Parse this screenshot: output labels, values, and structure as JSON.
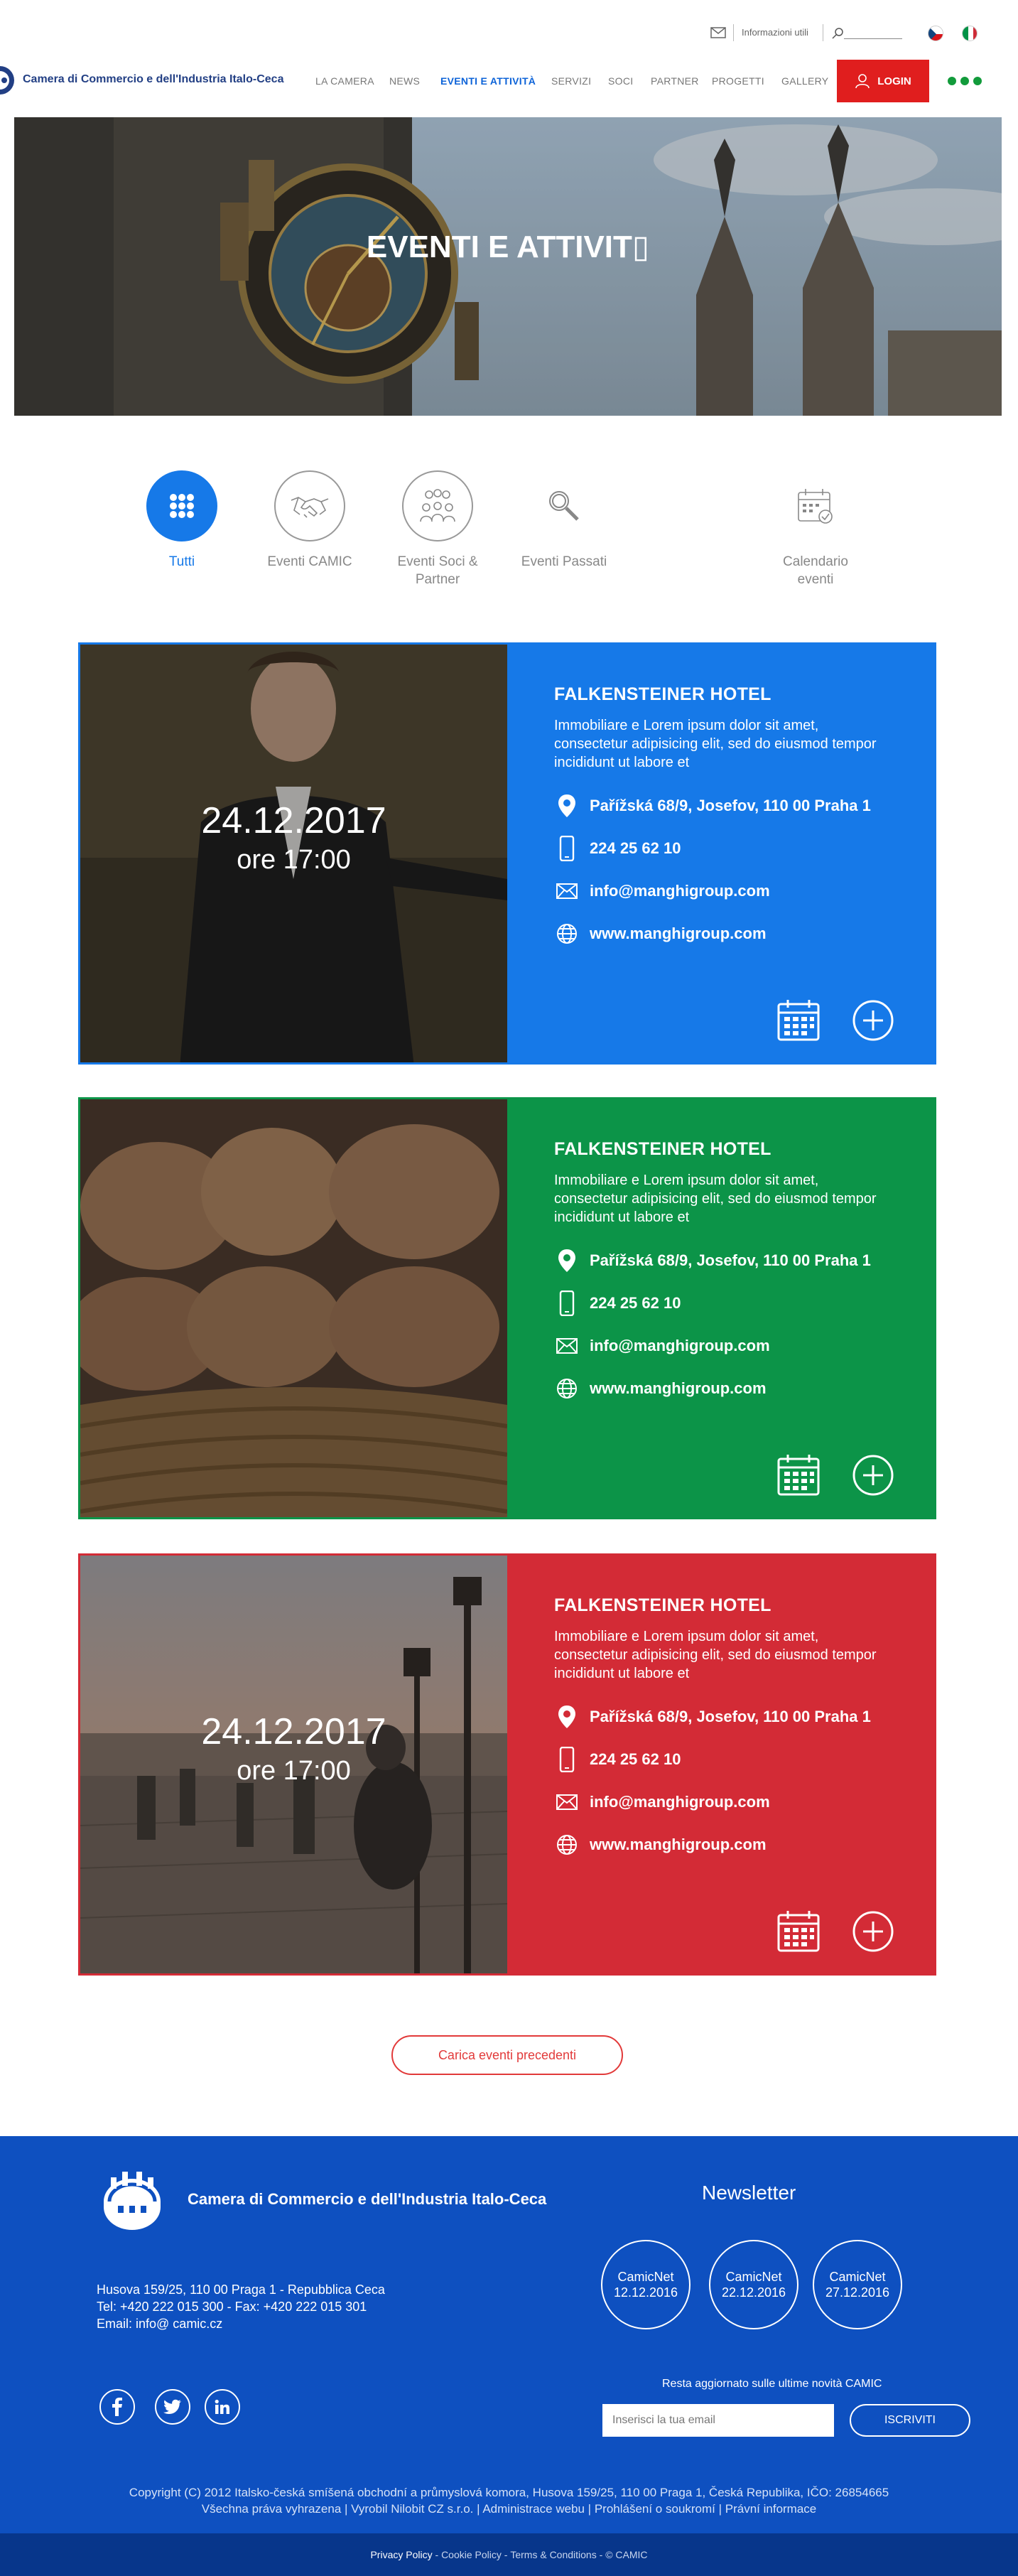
{
  "topbar": {
    "info_link": "Informazioni utili",
    "search_placeholder": ""
  },
  "header": {
    "org_name": "Camera di Commercio e dell'Industria Italo-Ceca",
    "nav": [
      "LA CAMERA",
      "NEWS",
      "EVENTI E ATTIVITÀ",
      "SERVIZI",
      "SOCI",
      "PARTNER",
      "PROGETTI",
      "GALLERY"
    ],
    "active_nav": "EVENTI E ATTIVITÀ",
    "login": "LOGIN",
    "accent_red": "#e01e1e",
    "accent_green": "#129b3b"
  },
  "hero": {
    "title": "EVENTI E ATTIVIT▯"
  },
  "filters": [
    {
      "label": "Tutti",
      "icon": "grid-icon",
      "active": true
    },
    {
      "label": "Eventi CAMIC",
      "icon": "handshake-icon",
      "active": false
    },
    {
      "label": "Eventi Soci & Partner",
      "icon": "people-icon",
      "active": false
    },
    {
      "label": "Eventi Passati",
      "icon": "magnifier-icon",
      "active": false
    },
    {
      "label": "Calendario eventi",
      "icon": "calendar-check-icon",
      "active": false
    }
  ],
  "events": [
    {
      "color": "#1679e8",
      "image": "conductor-photo",
      "date": "24.12.2017",
      "time": "ore 17:00",
      "title": "FALKENSTEINER HOTEL",
      "description": "Immobiliare e Lorem ipsum dolor sit amet, consectetur adipisicing elit, sed do eiusmod tempor incididunt ut labore et",
      "address": "Pařížská 68/9, Josefov, 110 00 Praha 1",
      "phone": "224 25 62 10",
      "email": "info@manghigroup.com",
      "website": "www.manghigroup.com"
    },
    {
      "color": "#0c9448",
      "image": "pastry-photo",
      "date": "",
      "time": "",
      "title": "FALKENSTEINER HOTEL",
      "description": "Immobiliare e Lorem ipsum dolor sit amet, consectetur adipisicing elit, sed do eiusmod tempor incididunt ut labore et",
      "address": "Pařížská 68/9, Josefov, 110 00 Praha 1",
      "phone": "224 25 62 10",
      "email": "info@manghigroup.com",
      "website": "www.manghigroup.com"
    },
    {
      "color": "#d32b36",
      "image": "charles-bridge-photo",
      "date": "24.12.2017",
      "time": "ore 17:00",
      "title": "FALKENSTEINER HOTEL",
      "description": "Immobiliare e Lorem ipsum dolor sit amet, consectetur adipisicing elit, sed do eiusmod tempor incididunt ut labore et",
      "address": "Pařížská 68/9, Josefov, 110 00 Praha 1",
      "phone": "224 25 62 10",
      "email": "info@manghigroup.com",
      "website": "www.manghigroup.com"
    }
  ],
  "load_more": "Carica eventi precedenti",
  "footer": {
    "org_name": "Camera di Commercio e dell'Industria Italo-Ceca",
    "address": "Husova 159/25, 110 00 Praga 1 - Repubblica Ceca",
    "tel": "Tel: +420 222 015 300 - Fax: +420 222 015 301",
    "email": "Email: info@ camic.cz",
    "newsletter_title": "Newsletter",
    "newsletters": [
      {
        "name": "CamicNet",
        "date": "12.12.2016"
      },
      {
        "name": "CamicNet",
        "date": "22.12.2016"
      },
      {
        "name": "CamicNet",
        "date": "27.12.2016"
      }
    ],
    "subscribe_caption": "Resta aggiornato sulle ultime novità CAMIC",
    "email_placeholder": "Inserisci la tua email",
    "subscribe_button": "ISCRIVITI",
    "social": [
      "facebook-icon",
      "twitter-icon",
      "linkedin-icon"
    ],
    "copyright_line1": "Copyright (C) 2012 Italsko-česká smíšená obchodní a průmyslová komora, Husova 159/25, 110 00 Praga 1, Česká Republika, IČO: 26854665",
    "copyright_line2": "Všechna práva vyhrazena | Vyrobil Nilobit CZ s.r.o. | Administrace webu | Prohlášení o soukromí | Právní informace",
    "bottom_links": {
      "privacy": "Privacy Policy",
      "cookie": "Cookie Policy",
      "terms": "Terms & Conditions",
      "brand": "© CAMIC"
    },
    "background": "#0e50c0"
  }
}
